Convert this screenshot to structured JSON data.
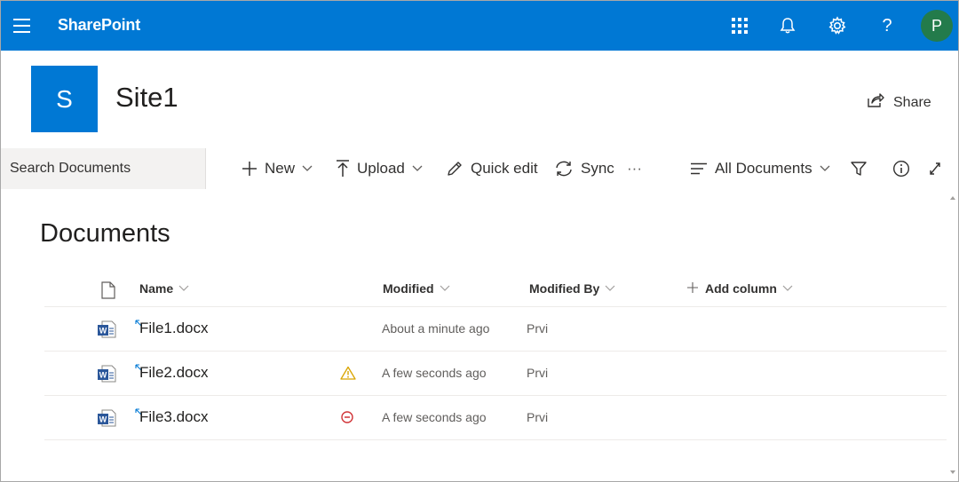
{
  "topbar": {
    "brand": "SharePoint",
    "avatar_initial": "P",
    "help_label": "?",
    "icons": [
      "menu-icon",
      "app-launcher-icon",
      "bell-icon",
      "gear-icon",
      "help-icon"
    ],
    "accent": "#0078d4",
    "avatar_color": "#237b4b"
  },
  "site": {
    "logo_letter": "S",
    "title": "Site1",
    "share_label": "Share"
  },
  "commandbar": {
    "search_placeholder": "Search Documents",
    "new_label": "New",
    "upload_label": "Upload",
    "quick_edit_label": "Quick edit",
    "sync_label": "Sync",
    "more_label": "···",
    "view_label": "All Documents"
  },
  "library": {
    "title": "Documents",
    "columns": {
      "name": "Name",
      "modified": "Modified",
      "modified_by": "Modified By",
      "add_column": "Add column"
    },
    "rows": [
      {
        "name": "File1.docx",
        "status": "none",
        "modified": "About a minute ago",
        "modified_by": "Prvi"
      },
      {
        "name": "File2.docx",
        "status": "warning",
        "modified": "A few seconds ago",
        "modified_by": "Prvi"
      },
      {
        "name": "File3.docx",
        "status": "blocked",
        "modified": "A few seconds ago",
        "modified_by": "Prvi"
      }
    ]
  },
  "colors": {
    "warning": "#d9a400",
    "error": "#d13438",
    "word_blue": "#2b579a"
  }
}
